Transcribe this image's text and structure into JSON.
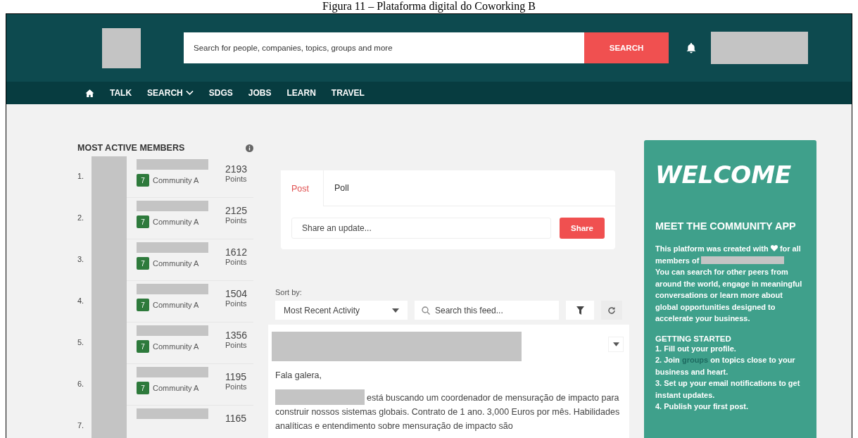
{
  "caption": "Figura 11 – Plataforma digital do Coworking B",
  "header": {
    "search": {
      "placeholder": "Search for people, companies, topics, groups and more"
    },
    "search_button": "SEARCH"
  },
  "nav": [
    {
      "kind": "home"
    },
    {
      "kind": "link",
      "label": "TALK"
    },
    {
      "kind": "dropdown",
      "label": "SEARCH"
    },
    {
      "kind": "link",
      "label": "SDGS"
    },
    {
      "kind": "link",
      "label": "JOBS"
    },
    {
      "kind": "link",
      "label": "LEARN"
    },
    {
      "kind": "link",
      "label": "TRAVEL"
    }
  ],
  "members": {
    "title": "MOST ACTIVE MEMBERS",
    "rows": [
      {
        "rank": "1.",
        "badge": "7",
        "community": "Community A",
        "points": "2193",
        "unit": "Points"
      },
      {
        "rank": "2.",
        "badge": "7",
        "community": "Community A",
        "points": "2125",
        "unit": "Points"
      },
      {
        "rank": "3.",
        "badge": "7",
        "community": "Community A",
        "points": "1612",
        "unit": "Points"
      },
      {
        "rank": "4.",
        "badge": "7",
        "community": "Community A",
        "points": "1504",
        "unit": "Points"
      },
      {
        "rank": "5.",
        "badge": "7",
        "community": "Community A",
        "points": "1356",
        "unit": "Points"
      },
      {
        "rank": "6.",
        "badge": "7",
        "community": "Community A",
        "points": "1195",
        "unit": "Points"
      },
      {
        "rank": "7.",
        "points": "1165"
      }
    ]
  },
  "composer": {
    "tabs": [
      {
        "label": "Post",
        "selected": true
      },
      {
        "label": "Poll",
        "selected": false
      }
    ],
    "input": {
      "placeholder": "Share an update..."
    },
    "button": "Share"
  },
  "feed_controls": {
    "sort_label": "Sort by:",
    "sort_value": "Most Recent Activity",
    "search": {
      "placeholder": "Search this feed..."
    }
  },
  "post": {
    "greeting": "Fala galera,",
    "body": "está buscando um coordenador de mensuração de impacto para construir nossos sistemas globais. Contrato de 1 ano. 3,000 Euros por mês. Habilidades analíticas e entendimento sobre mensuração de impacto são"
  },
  "welcome": {
    "title": "WELCOME",
    "subtitle": "MEET THE COMMUNITY APP",
    "intro_start": "This platform was created with",
    "intro_end": "for all members of",
    "intro_rest": "You can search for other peers from around the world, engage in meaningful conversations or learn more about global opportunities designed to accelerate your business.",
    "steps_title": "GETTING STARTED",
    "steps": [
      {
        "text": "1. Fill out your profile."
      },
      {
        "text": "2. Join",
        "link": "groups",
        "after": "on topics close to your business and heart."
      },
      {
        "text": "3. Set up your email notifications to get instant updates."
      },
      {
        "text": "4. Publish your first post."
      }
    ]
  }
}
